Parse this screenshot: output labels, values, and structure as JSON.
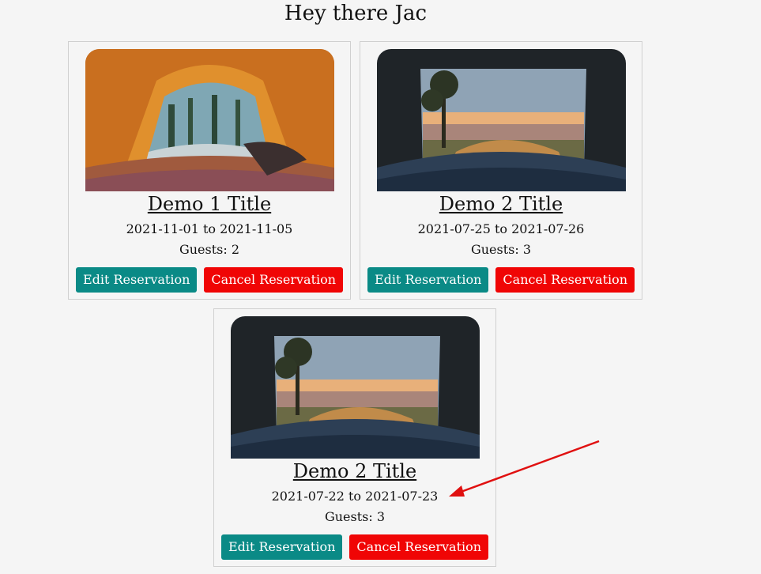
{
  "greeting": "Hey there Jac",
  "reservations": [
    {
      "title": "Demo 1 Title",
      "dates": "2021-11-01 to 2021-11-05",
      "guests": "Guests: 2",
      "edit_label": "Edit Reservation",
      "cancel_label": "Cancel Reservation",
      "image": "tent-forest-view"
    },
    {
      "title": "Demo 2 Title",
      "dates": "2021-07-25 to 2021-07-26",
      "guests": "Guests: 3",
      "edit_label": "Edit Reservation",
      "cancel_label": "Cancel Reservation",
      "image": "car-trunk-sunset-view"
    },
    {
      "title": "Demo 2 Title",
      "dates": "2021-07-22 to 2021-07-23",
      "guests": "Guests: 3",
      "edit_label": "Edit Reservation",
      "cancel_label": "Cancel Reservation",
      "image": "car-trunk-sunset-view"
    }
  ],
  "colors": {
    "edit_button": "#0a8a86",
    "cancel_button": "#f00505",
    "annotation_arrow": "#e01010"
  }
}
